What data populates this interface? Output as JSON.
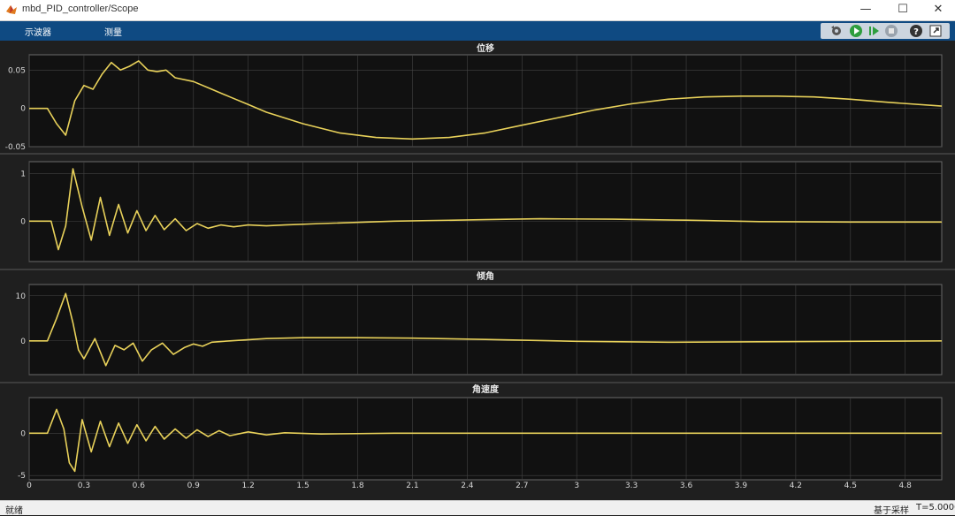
{
  "window": {
    "title": "mbd_PID_controller/Scope",
    "minimize_glyph": "—",
    "maximize_glyph": "☐",
    "close_glyph": "✕"
  },
  "menu": {
    "items": [
      "示波器",
      "测量"
    ]
  },
  "toolbar_icons": [
    "settings-icon",
    "run-icon",
    "step-forward-icon",
    "stop-icon",
    "help-icon",
    "undock-icon"
  ],
  "colors": {
    "signal": "#e8d15a",
    "axes_bg": "#111111",
    "figure_bg": "#1f1f1f",
    "grid": "#444444",
    "toolbar_bg": "#0f4a82"
  },
  "x_ticks": [
    "0",
    "0.3",
    "0.6",
    "0.9",
    "1.2",
    "1.5",
    "1.8",
    "2.1",
    "2.4",
    "2.7",
    "3",
    "3.3",
    "3.6",
    "3.9",
    "4.2",
    "4.5",
    "4.8"
  ],
  "chart_data": [
    {
      "type": "line",
      "title": "位移",
      "xlim": [
        0,
        5
      ],
      "ylim": [
        -0.05,
        0.07
      ],
      "y_ticks": [
        "0.05",
        "0",
        "-0.05"
      ],
      "x": [
        0,
        0.1,
        0.15,
        0.2,
        0.25,
        0.3,
        0.35,
        0.4,
        0.45,
        0.5,
        0.55,
        0.6,
        0.65,
        0.7,
        0.75,
        0.8,
        0.9,
        1.0,
        1.1,
        1.2,
        1.3,
        1.5,
        1.7,
        1.9,
        2.1,
        2.3,
        2.5,
        2.7,
        2.9,
        3.1,
        3.3,
        3.5,
        3.7,
        3.9,
        4.1,
        4.3,
        4.5,
        4.7,
        5.0
      ],
      "y": [
        0,
        0,
        -0.02,
        -0.035,
        0.01,
        0.03,
        0.025,
        0.045,
        0.06,
        0.05,
        0.055,
        0.062,
        0.05,
        0.048,
        0.05,
        0.04,
        0.035,
        0.025,
        0.015,
        0.005,
        -0.005,
        -0.02,
        -0.032,
        -0.038,
        -0.04,
        -0.038,
        -0.032,
        -0.022,
        -0.012,
        -0.002,
        0.006,
        0.012,
        0.015,
        0.016,
        0.016,
        0.015,
        0.012,
        0.008,
        0.003
      ]
    },
    {
      "type": "line",
      "title": "",
      "xlim": [
        0,
        5
      ],
      "ylim": [
        -0.85,
        1.25
      ],
      "y_ticks": [
        "1",
        "0"
      ],
      "x": [
        0,
        0.12,
        0.16,
        0.2,
        0.24,
        0.29,
        0.34,
        0.39,
        0.44,
        0.49,
        0.54,
        0.59,
        0.64,
        0.69,
        0.74,
        0.8,
        0.86,
        0.92,
        0.98,
        1.05,
        1.12,
        1.2,
        1.3,
        1.4,
        1.6,
        2.0,
        2.5,
        2.8,
        3.2,
        3.6,
        4.0,
        4.5,
        5.0
      ],
      "y": [
        0,
        0,
        -0.6,
        -0.1,
        1.1,
        0.3,
        -0.4,
        0.5,
        -0.3,
        0.35,
        -0.25,
        0.22,
        -0.2,
        0.12,
        -0.18,
        0.05,
        -0.2,
        -0.05,
        -0.15,
        -0.08,
        -0.12,
        -0.08,
        -0.1,
        -0.08,
        -0.05,
        0,
        0.03,
        0.05,
        0.04,
        0.02,
        -0.01,
        -0.02,
        -0.02
      ]
    },
    {
      "type": "line",
      "title": "倾角",
      "xlim": [
        0,
        5
      ],
      "ylim": [
        -7.5,
        12.5
      ],
      "y_ticks": [
        "10",
        "0"
      ],
      "x": [
        0,
        0.1,
        0.15,
        0.2,
        0.24,
        0.27,
        0.3,
        0.36,
        0.42,
        0.47,
        0.52,
        0.57,
        0.62,
        0.67,
        0.73,
        0.79,
        0.85,
        0.9,
        0.95,
        1.0,
        1.1,
        1.3,
        1.5,
        1.8,
        2.1,
        2.5,
        3.0,
        3.5,
        4.0,
        4.5,
        5.0
      ],
      "y": [
        0,
        0,
        5,
        10.5,
        4,
        -2,
        -4,
        0.5,
        -5.5,
        -1,
        -2,
        -0.5,
        -4.5,
        -2,
        -0.5,
        -3,
        -1.5,
        -0.7,
        -1.2,
        -0.3,
        0,
        0.5,
        0.7,
        0.7,
        0.6,
        0.3,
        -0.1,
        -0.3,
        -0.2,
        -0.1,
        0
      ]
    },
    {
      "type": "line",
      "title": "角速度",
      "xlim": [
        0,
        5
      ],
      "ylim": [
        -5.5,
        4.2
      ],
      "y_ticks": [
        "0",
        "-5"
      ],
      "x": [
        0,
        0.1,
        0.15,
        0.19,
        0.22,
        0.25,
        0.29,
        0.34,
        0.39,
        0.44,
        0.49,
        0.54,
        0.59,
        0.64,
        0.69,
        0.74,
        0.8,
        0.86,
        0.92,
        0.98,
        1.04,
        1.1,
        1.2,
        1.3,
        1.4,
        1.6,
        2.0,
        2.5,
        3.0,
        3.5,
        4.0,
        5.0
      ],
      "y": [
        0,
        0,
        2.8,
        0.5,
        -3.5,
        -4.5,
        1.6,
        -2.2,
        1.4,
        -1.6,
        1.2,
        -1.2,
        1,
        -0.9,
        0.8,
        -0.7,
        0.5,
        -0.6,
        0.4,
        -0.4,
        0.3,
        -0.3,
        0.15,
        -0.2,
        0.05,
        -0.1,
        0,
        0,
        0,
        0,
        0,
        0
      ]
    }
  ],
  "status": {
    "left": "就绪",
    "mode": "基于采样",
    "time": "T=5.0000"
  }
}
